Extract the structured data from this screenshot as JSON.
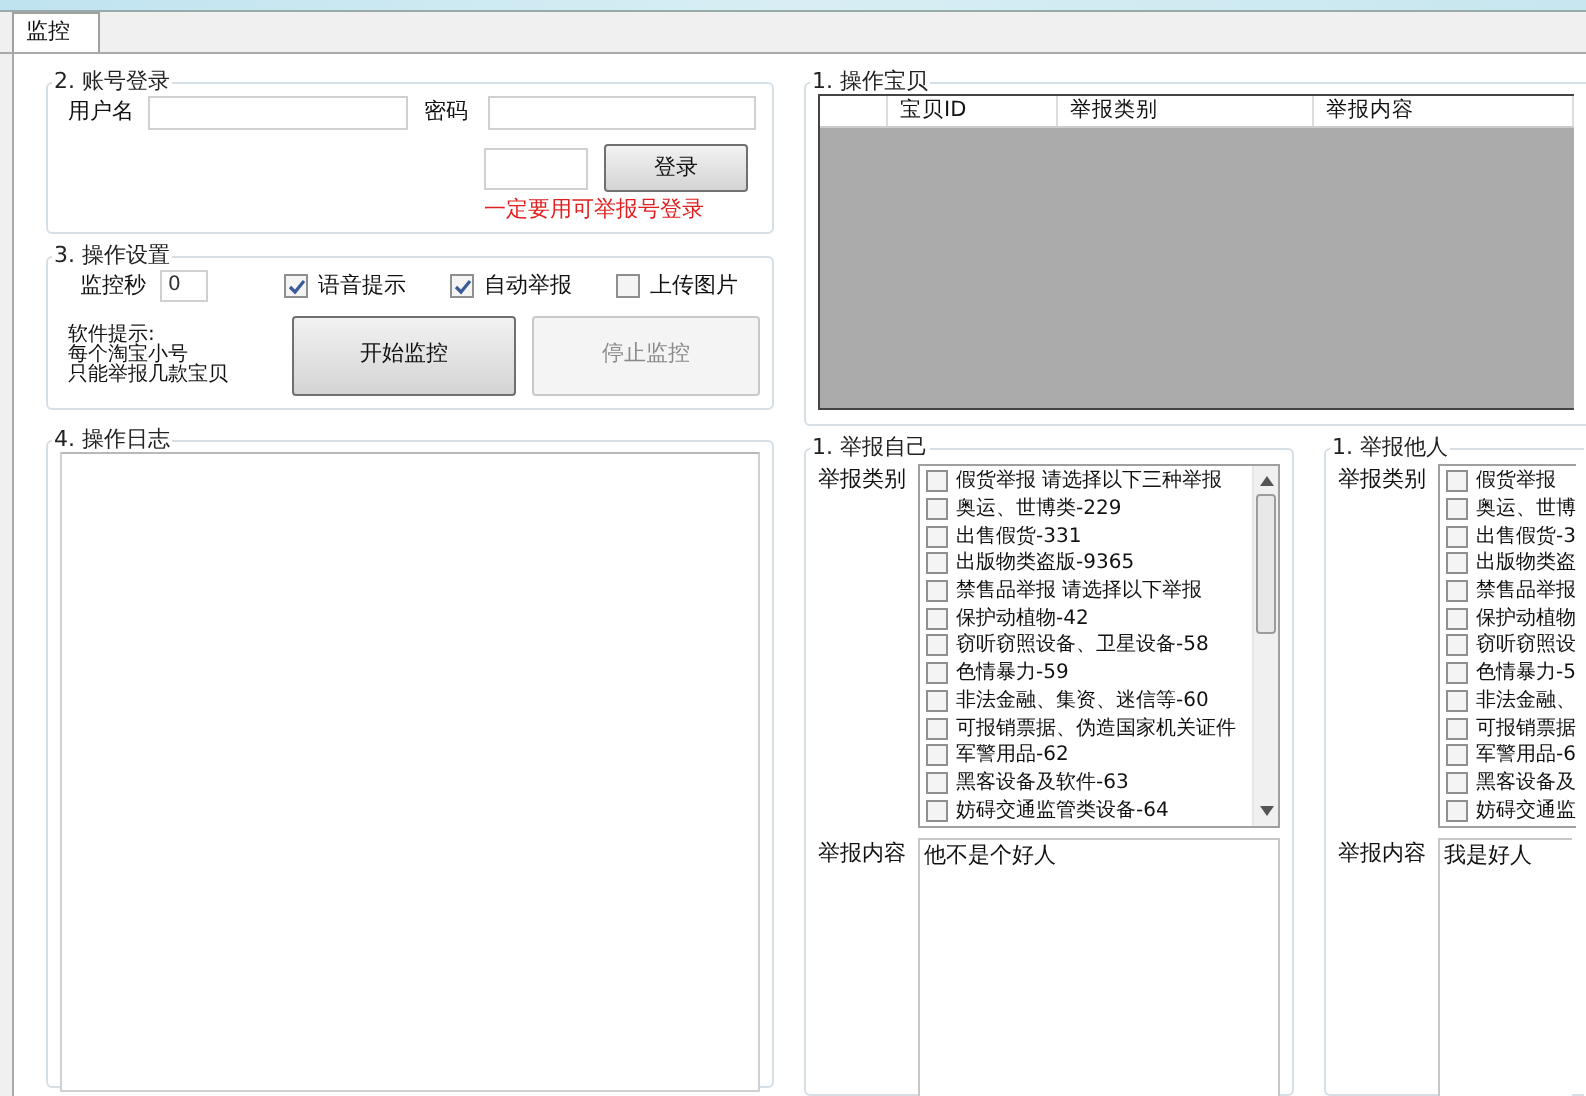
{
  "tabs": [
    {
      "label": "监控",
      "selected": true
    }
  ],
  "login": {
    "title": "2. 账号登录",
    "username_label": "用户名",
    "password_label": "密码",
    "login_button": "登录",
    "warning": "一定要用可举报号登录"
  },
  "settings": {
    "title": "3. 操作设置",
    "seconds_label": "监控秒",
    "seconds_value": "0",
    "options": [
      {
        "label": "语音提示",
        "checked": true
      },
      {
        "label": "自动举报",
        "checked": true
      },
      {
        "label": "上传图片",
        "checked": false
      }
    ],
    "hint_lines": [
      "软件提示:",
      "每个淘宝小号",
      "只能举报几款宝贝"
    ],
    "start_button": {
      "label": "开始监控",
      "disabled": false
    },
    "stop_button": {
      "label": "停止监控",
      "disabled": true
    }
  },
  "log": {
    "title": "4. 操作日志"
  },
  "items": {
    "title": "1. 操作宝贝",
    "columns": [
      "宝贝ID",
      "举报类别",
      "举报内容"
    ]
  },
  "report_panels": [
    {
      "title": "1. 举报自己",
      "category_label": "举报类别",
      "content_label": "举报内容",
      "content": "他不是个好人",
      "scrollbar": true,
      "categories": [
        {
          "label": "假货举报 请选择以下三种举报",
          "checked": false
        },
        {
          "label": "奥运、世博类-229",
          "checked": false
        },
        {
          "label": "出售假货-331",
          "checked": false
        },
        {
          "label": "出版物类盗版-9365",
          "checked": false
        },
        {
          "label": "禁售品举报 请选择以下举报",
          "checked": false
        },
        {
          "label": "保护动植物-42",
          "checked": false
        },
        {
          "label": "窃听窃照设备、卫星设备-58",
          "checked": false
        },
        {
          "label": "色情暴力-59",
          "checked": false
        },
        {
          "label": "非法金融、集资、迷信等-60",
          "checked": false
        },
        {
          "label": "可报销票据、伪造国家机关证件",
          "checked": false
        },
        {
          "label": "军警用品-62",
          "checked": false
        },
        {
          "label": "黑客设备及软件-63",
          "checked": false
        },
        {
          "label": "妨碍交通监管类设备-64",
          "checked": false
        }
      ]
    },
    {
      "title": "1. 举报他人",
      "category_label": "举报类别",
      "content_label": "举报内容",
      "content": "我是好人",
      "scrollbar": false,
      "categories": [
        {
          "label": "假货举报",
          "checked": false
        },
        {
          "label": "奥运、世博",
          "checked": false
        },
        {
          "label": "出售假货-3",
          "checked": false
        },
        {
          "label": "出版物类盗",
          "checked": false
        },
        {
          "label": "禁售品举报",
          "checked": false
        },
        {
          "label": "保护动植物",
          "checked": false
        },
        {
          "label": "窃听窃照设",
          "checked": false
        },
        {
          "label": "色情暴力-5",
          "checked": false
        },
        {
          "label": "非法金融、",
          "checked": false
        },
        {
          "label": "可报销票据",
          "checked": false
        },
        {
          "label": "军警用品-6",
          "checked": false
        },
        {
          "label": "黑客设备及",
          "checked": false
        },
        {
          "label": "妨碍交通监",
          "checked": false
        }
      ]
    }
  ]
}
